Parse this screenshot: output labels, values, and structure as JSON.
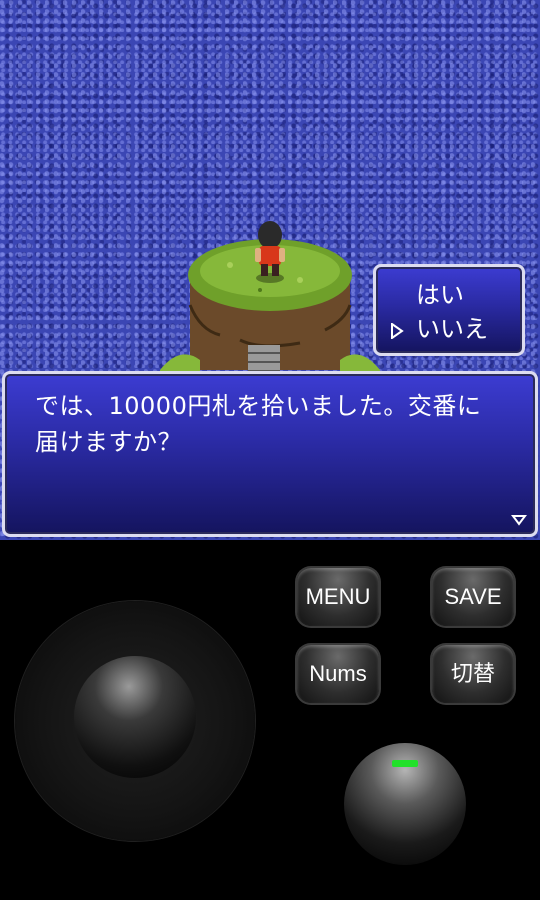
{
  "game": {
    "scene": "ocean-island-map"
  },
  "choice_box": {
    "option_yes": "はい",
    "option_no": "いいえ",
    "selected": "いいえ"
  },
  "dialog": {
    "message_line1": "では、10000円札を拾いました。交番に",
    "message_line2": "届けますか？"
  },
  "controls": {
    "menu": "MENU",
    "save": "SAVE",
    "nums": "Nums",
    "switch": "切替"
  },
  "colors": {
    "ocean": "#3b46b4",
    "window_top": "#3c3cd2",
    "window_bottom": "#14145e",
    "led": "#22e02a"
  }
}
